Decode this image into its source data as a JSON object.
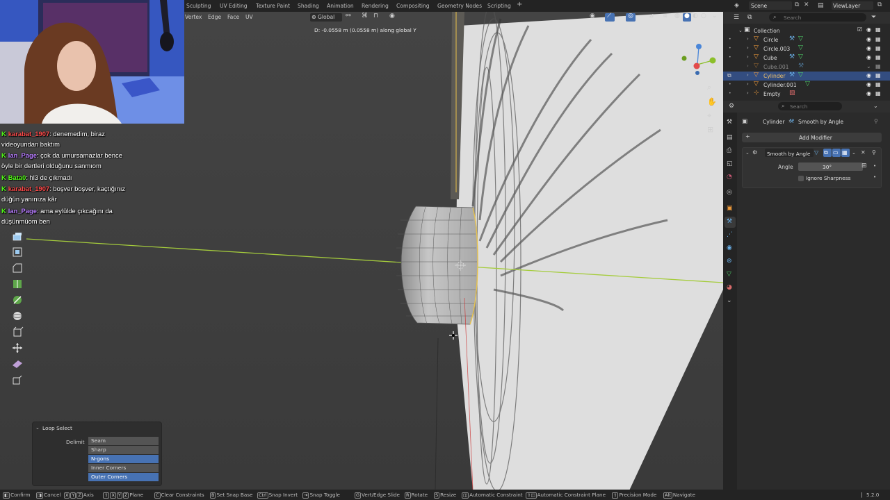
{
  "top_bar": {
    "workspace_tabs": [
      "Sculpting",
      "UV Editing",
      "Texture Paint",
      "Shading",
      "Animation",
      "Rendering",
      "Compositing",
      "Geometry Nodes",
      "Scripting"
    ],
    "add_tab": "+",
    "scene_label": "Scene",
    "search_placeholder": "Search",
    "view_layer_label": "ViewLayer"
  },
  "viewport_header": {
    "menus": [
      "Vertex",
      "Edge",
      "Face",
      "UV"
    ],
    "orientation": "Global"
  },
  "status_message": "D: -0.0558 m (0.0558 m) along global Y",
  "chat": [
    {
      "user": "karabat_1907",
      "msg": ": denemedim, biraz",
      "color": "#ff4b4b"
    },
    {
      "user": "",
      "msg": "videoyundan baktım",
      "color": ""
    },
    {
      "user": "Ian_Page",
      "msg": ": çok da umursamazlar bence",
      "color": "#b77cff"
    },
    {
      "user": "",
      "msg": "öyle bir dertleri olduğunu sanmıom",
      "color": ""
    },
    {
      "user": "Bata0",
      "msg": ": hl3 de çıkmadı",
      "color": "#53fc18"
    },
    {
      "user": "karabat_1907",
      "msg": ": boşver boşver, kaçtığınız",
      "color": "#ff4b4b"
    },
    {
      "user": "",
      "msg": "düğün yanınıza kâr",
      "color": ""
    },
    {
      "user": "Ian_Page",
      "msg": ": ama eylülde çıkcağını da",
      "color": "#b77cff"
    },
    {
      "user": "",
      "msg": "düşünmüom ben",
      "color": ""
    }
  ],
  "outliner": {
    "collection": "Collection",
    "items": [
      {
        "name": "Circle",
        "dim": false,
        "selected": false
      },
      {
        "name": "Circle.003",
        "dim": false,
        "selected": false
      },
      {
        "name": "Cube",
        "dim": false,
        "selected": false
      },
      {
        "name": "Cube.001",
        "dim": true,
        "selected": false
      },
      {
        "name": "Cylinder",
        "dim": false,
        "selected": true
      },
      {
        "name": "Cylinder.001",
        "dim": false,
        "selected": false
      },
      {
        "name": "Empty",
        "dim": false,
        "selected": false
      }
    ]
  },
  "properties": {
    "search_placeholder": "Search",
    "breadcrumb_object": "Cylinder",
    "breadcrumb_modifier": "Smooth by Angle",
    "add_modifier": "Add Modifier",
    "modifier_name": "Smooth by Angle",
    "angle_label": "Angle",
    "angle_value": "30°",
    "ignore_sharpness": "Ignore Sharpness"
  },
  "loop_select": {
    "title": "Loop Select",
    "delimit_label": "Delimit",
    "options": [
      {
        "label": "Seam",
        "selected": false
      },
      {
        "label": "Sharp",
        "selected": false
      },
      {
        "label": "N-gons",
        "selected": true
      },
      {
        "label": "Inner Corners",
        "selected": false
      },
      {
        "label": "Outer Corners",
        "selected": true
      }
    ]
  },
  "status_bar": {
    "confirm": "Confirm",
    "cancel": "Cancel",
    "axis": "Axis",
    "plane": "Plane",
    "clear_constraints": "Clear Constraints",
    "set_snap_base": "Set Snap Base",
    "snap_invert": "Snap Invert",
    "snap_toggle": "Snap Toggle",
    "vert_edge_slide": "Vert/Edge Slide",
    "rotate": "Rotate",
    "resize": "Resize",
    "automatic_constraint": "Automatic Constraint",
    "automatic_constraint_plane": "Automatic Constraint Plane",
    "precision_mode": "Precision Mode",
    "navigate": "Navigate",
    "version": "5.2.0"
  },
  "colors": {
    "accent": "#4772b3",
    "x_axis": "#a5cc3c",
    "kick_green": "#53fc18",
    "viewport_bg": "#3b3b3b"
  }
}
